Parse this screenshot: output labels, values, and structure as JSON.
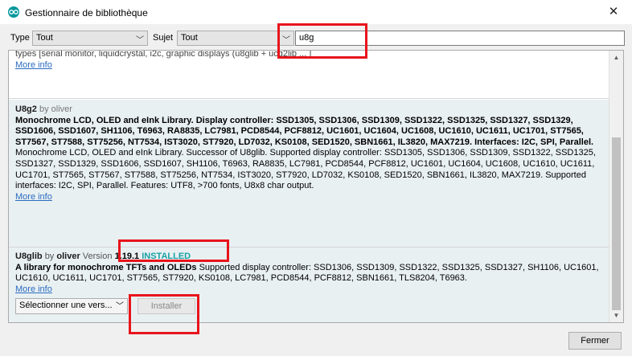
{
  "window": {
    "title": "Gestionnaire de bibliothèque",
    "close_glyph": "✕"
  },
  "filters": {
    "type_label": "Type",
    "type_value": "Tout",
    "subject_label": "Sujet",
    "subject_value": "Tout",
    "search_value": "u8g"
  },
  "libraries": [
    {
      "partial_text": "types [serial monitor, liquidcrystal, i2c, graphic displays (u8glib + ucg2lib ... ]",
      "more_info": "More info"
    },
    {
      "name": "U8g2",
      "by": "by",
      "author": "oliver",
      "summary": "Monochrome LCD, OLED and eInk Library. Display controller: SSD1305, SSD1306, SSD1309, SSD1322, SSD1325, SSD1327, SSD1329, SSD1606, SSD1607, SH1106, T6963, RA8835, LC7981, PCD8544, PCF8812, UC1601, UC1604, UC1608, UC1610, UC1611, UC1701, ST7565, ST7567, ST7588, ST75256, NT7534, IST3020, ST7920, LD7032, KS0108, SED1520, SBN1661, IL3820, MAX7219. Interfaces: I2C, SPI, Parallel.",
      "description": "Monochrome LCD, OLED and eInk Library. Successor of U8glib. Supported display controller: SSD1305, SSD1306, SSD1309, SSD1322, SSD1325, SSD1327, SSD1329, SSD1606, SSD1607, SH1106, T6963, RA8835, LC7981, PCD8544, PCF8812, UC1601, UC1604, UC1608, UC1610, UC1611, UC1701, ST7565, ST7567, ST7588, ST75256, NT7534, IST3020, ST7920, LD7032, KS0108, SED1520, SBN1661, IL3820, MAX7219. Supported interfaces: I2C, SPI, Parallel. Features: UTF8, >700 fonts, U8x8 char output.",
      "more_info": "More info"
    },
    {
      "name": "U8glib",
      "by": "by",
      "author": "oliver",
      "version_label": "Version",
      "version": "1.19.1",
      "status": "INSTALLED",
      "summary": "A library for monochrome TFTs and OLEDs",
      "description": "Supported display controller: SSD1306, SSD1309, SSD1322, SSD1325, SSD1327, SH1106, UC1601, UC1610, UC1611, UC1701, ST7565, ST7920, KS0108, LC7981, PCD8544, PCF8812, SBN1661, TLS8204, T6963.",
      "more_info": "More info",
      "version_select": "Sélectionner une vers...",
      "install_label": "Installer"
    }
  ],
  "footer": {
    "close_label": "Fermer"
  },
  "colors": {
    "highlight": "#e8141c",
    "installed": "#17a1a5",
    "link": "#2a6cbf",
    "selected_bg": "#e9f0f2"
  },
  "icons": {
    "app": "arduino-icon",
    "dropdown": "chevron-down-icon"
  }
}
